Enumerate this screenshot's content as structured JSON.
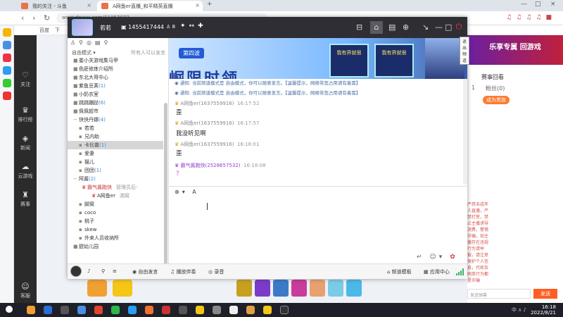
{
  "browser": {
    "tabs": [
      {
        "label": "我的关注 - 斗鱼"
      },
      {
        "label": "A网鱼er直播_和平精英直播"
      }
    ],
    "url": "www.douyu.com/11057077"
  },
  "bookmarks": [
    {
      "label": "百度"
    },
    {
      "label": "下"
    }
  ],
  "douyu_nav": [
    {
      "label": "关注",
      "icon": "heart-icon"
    },
    {
      "label": "排行榜",
      "icon": "rank-icon"
    },
    {
      "label": "新闻",
      "icon": "news-icon"
    },
    {
      "label": "云游戏",
      "icon": "cloud-game-icon"
    },
    {
      "label": "赛事",
      "icon": "trophy-icon"
    },
    {
      "label": "客服",
      "icon": "service-icon"
    }
  ],
  "right_page": {
    "banner": "乐享专属 回游戏",
    "header": "赛事回看",
    "tabs": [
      "1",
      "粉丝(0)"
    ],
    "badge": "成为贵族",
    "notice": "严禁未成年人直播，严禁打赏，禁止主播诱导消费，警惕诈骗，如主播存在违规行为请举报，请注意保护个人信息，代练及刷单行为都是诈骗"
  },
  "yy": {
    "title": {
      "name": "若若",
      "id": "1455417444",
      "online": "8",
      "exit_tooltip": "退出频道"
    },
    "tree": {
      "mode": "自由模式",
      "all_mode": "所有人可以发言",
      "rows": [
        {
          "type": "channel",
          "label": "娄小关游戏集马甲",
          "exp": "■"
        },
        {
          "type": "channel",
          "label": "色胚修炼介绍所",
          "exp": "■"
        },
        {
          "type": "channel",
          "label": "东北大哥中心",
          "exp": "■"
        },
        {
          "type": "channel",
          "label": "紫鱼豆荚",
          "count": "(1)",
          "exp": "■"
        },
        {
          "type": "channel",
          "label": "小奶衣室",
          "exp": "■"
        },
        {
          "type": "channel",
          "label": "跳跳蹦跶",
          "count": "(6)",
          "exp": "■"
        },
        {
          "type": "channel",
          "label": "佩佩超市",
          "exp": "■"
        },
        {
          "type": "channel",
          "label": "快快丹娜",
          "count": "(4)",
          "exp": "−"
        },
        {
          "type": "sub",
          "label": "若若"
        },
        {
          "type": "sub",
          "label": "兄内助"
        },
        {
          "type": "sub",
          "label": "卡比兽",
          "count": "(1)",
          "selected": true
        },
        {
          "type": "sub",
          "label": "爱妻"
        },
        {
          "type": "sub",
          "label": "猫儿"
        },
        {
          "type": "sub",
          "label": "团团",
          "count": "(1)"
        },
        {
          "type": "channel",
          "label": "阿酱",
          "count": "(2)",
          "exp": "−"
        },
        {
          "type": "user",
          "label": "霸气酱跑快",
          "extra": "管理员后-"
        },
        {
          "type": "user2",
          "label": "A网鱼er",
          "extra": "酒窝"
        },
        {
          "type": "sub",
          "label": "脚窝"
        },
        {
          "type": "sub",
          "label": "coco"
        },
        {
          "type": "sub",
          "label": "桃子"
        },
        {
          "type": "sub",
          "label": "skew"
        },
        {
          "type": "sub",
          "label": "外来人员收纳所"
        },
        {
          "type": "channel",
          "label": "甜幼儿园",
          "exp": "■"
        }
      ]
    },
    "banner": {
      "badge": "第四波",
      "text": "崛限时领",
      "card1": "我有界就很",
      "card2": "我有界就很"
    },
    "chat": {
      "notices": [
        "通知: 当前频道模式是 自由模式，你可以随意发言。【温馨提示，网络带宽占用请有着需】",
        "通知: 当前频道模式是 自由模式，你可以随意发言。【温馨提示，网络带宽占用请有着需】"
      ],
      "messages": [
        {
          "sender": "A网鱼er(1637559916)",
          "time": "16:17:52",
          "text": "歪"
        },
        {
          "sender": "A网鱼er(1637559916)",
          "time": "16:17:57",
          "text": "我没听见啊"
        },
        {
          "sender": "A网鱼er(1637559916)",
          "time": "16:18:01",
          "text": "歪"
        },
        {
          "sender": "霸气酱跑快(2528657532)",
          "time": "16:18:08",
          "text": "?"
        }
      ]
    },
    "bottom": {
      "free_speak": "自由发言",
      "play_music": "播放伴奏",
      "record": "录音",
      "channel_template": "频道模板",
      "app_center": "应用中心"
    }
  },
  "clock": {
    "time": "16:18",
    "date": "2022/8/21"
  },
  "tray": {
    "ime": "中"
  }
}
